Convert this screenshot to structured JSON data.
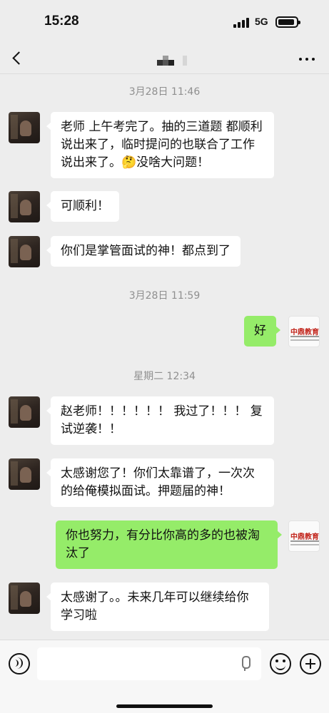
{
  "status_bar": {
    "time": "15:28",
    "network": "5G"
  },
  "nav": {
    "title_icon": "pixelated-contact-name",
    "more_icon": "more-dots-icon",
    "back_icon": "back-chevron-icon"
  },
  "chat": {
    "time_1": "3月28日 11:46",
    "msg_1": "老师 上午考完了。抽的三道题 都顺利说出来了，临时提问的也联合了工作说出来了。",
    "msg_1_emoji": "🤔",
    "msg_1_tail": "没啥大问题！",
    "msg_2": "可顺利！",
    "msg_3": "你们是掌管面试的神！都点到了",
    "time_2": "3月28日 11:59",
    "msg_4": "好",
    "time_3": "星期二 12:34",
    "msg_5": "赵老师！！！！！！ 我过了！！！ 复试逆袭！！",
    "msg_6": "太感谢您了！你们太靠谱了，一次次的给俺模拟面试。押题届的神！",
    "msg_7": "你也努力，有分比你高的多的也被淘汰了",
    "msg_8": "太感谢了。。未来几年可以继续给你学习啦",
    "brand_avatar_text": "中鼎教育"
  },
  "colors": {
    "background": "#ededed",
    "bubble_in": "#ffffff",
    "bubble_out": "#95ec69",
    "time_label": "#8f8f8f"
  }
}
